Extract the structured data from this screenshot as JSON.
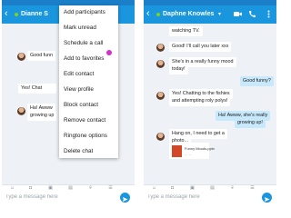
{
  "left_phone": {
    "contact_name": "Dianne S",
    "menu_items": [
      "Add participants",
      "Mark unread",
      "Schedule a call",
      "Add to favorites",
      "Edit contact",
      "View profile",
      "Block contact",
      "Remove contact",
      "Ringtone options",
      "Delete chat"
    ],
    "messages": [
      "Good funn",
      "Yes! Chat",
      "Ha! Awww",
      "growing up"
    ],
    "composer_placeholder": "Type a message here"
  },
  "right_phone": {
    "contact_name": "Daphne Knowles",
    "messages": [
      "watching TV.",
      "Good! I'll call you later xxx",
      "She's in a really funny mood",
      "today!",
      "Good funny?",
      "Yes! Chatting to the fishies",
      "and attempting roly polys!",
      "Ha! Awww, she's really",
      "growing up!",
      "Hang on, I need to get a",
      "photo...",
      "Funny Moods.pptx",
      "...  ..."
    ],
    "composer_placeholder": "Type a message here"
  },
  "colors": {
    "app_bar": "#1a96df",
    "status_bar": "#1a7fc8",
    "outgoing_bubble": "#c7e9fb",
    "presence": "#7cd322",
    "menu_highlight_dot": "#d62fce",
    "file_icon": "#d24726"
  },
  "icons": [
    "back-arrow-icon",
    "video-call-icon",
    "phone-call-icon",
    "more-options-icon",
    "emoji-icon",
    "camera-icon",
    "image-icon",
    "file-icon",
    "location-icon",
    "contacts-icon",
    "send-icon"
  ]
}
